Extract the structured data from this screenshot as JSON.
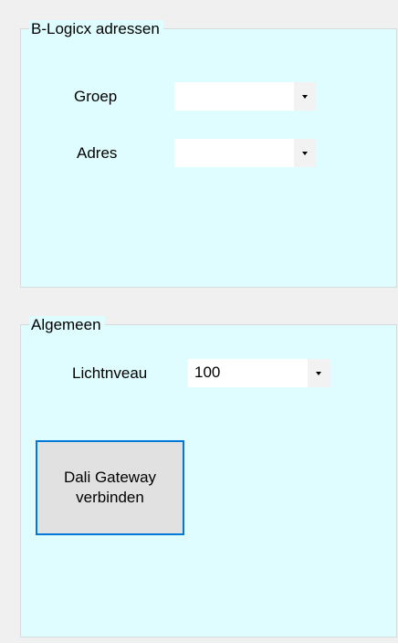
{
  "groups": {
    "blogicx": {
      "title": "B-Logicx adressen",
      "groep": {
        "label": "Groep",
        "value": ""
      },
      "adres": {
        "label": "Adres",
        "value": ""
      }
    },
    "algemeen": {
      "title": "Algemeen",
      "lichtniveau": {
        "label": "Lichtnveau",
        "value": "100"
      },
      "connect_button": "Dali Gateway\nverbinden"
    }
  },
  "colors": {
    "window_background": "#f0f0f0",
    "group_background": "#dffdfe",
    "button_background": "#e1e1e1",
    "button_focus_border": "#0078d7"
  },
  "icons": {
    "dropdown": "chevron-down-icon"
  }
}
